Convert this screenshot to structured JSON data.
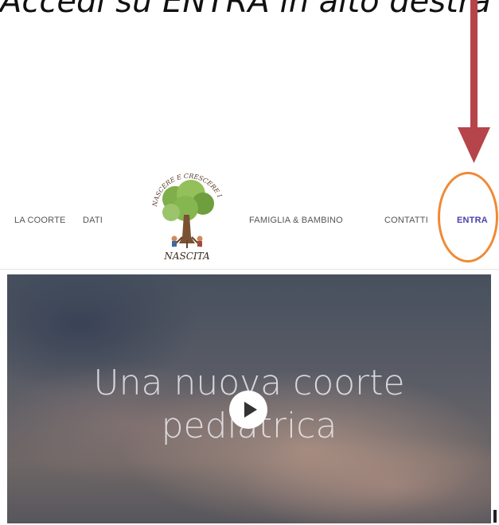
{
  "instruction": {
    "text": "Accedi su ENTRA in alto destra"
  },
  "nav": {
    "items": [
      {
        "label": "LA COORTE"
      },
      {
        "label": "DATI"
      },
      {
        "label": "FAMIGLIA & BAMBINO"
      },
      {
        "label": "CONTATTI"
      },
      {
        "label": "ENTRA"
      }
    ],
    "logo": {
      "top_text": "NASCERE E CRESCERE IN ITALIA",
      "bottom_text": "NASCITA"
    }
  },
  "hero": {
    "title_line1": "Una nuova coorte",
    "title_line2": "pediatrica"
  },
  "colors": {
    "arrow": "#b5454a",
    "highlight": "#ef8a35",
    "active_link": "#4b3fa8"
  },
  "icons": {
    "play": "play-icon",
    "arrow": "arrow-down-icon"
  }
}
